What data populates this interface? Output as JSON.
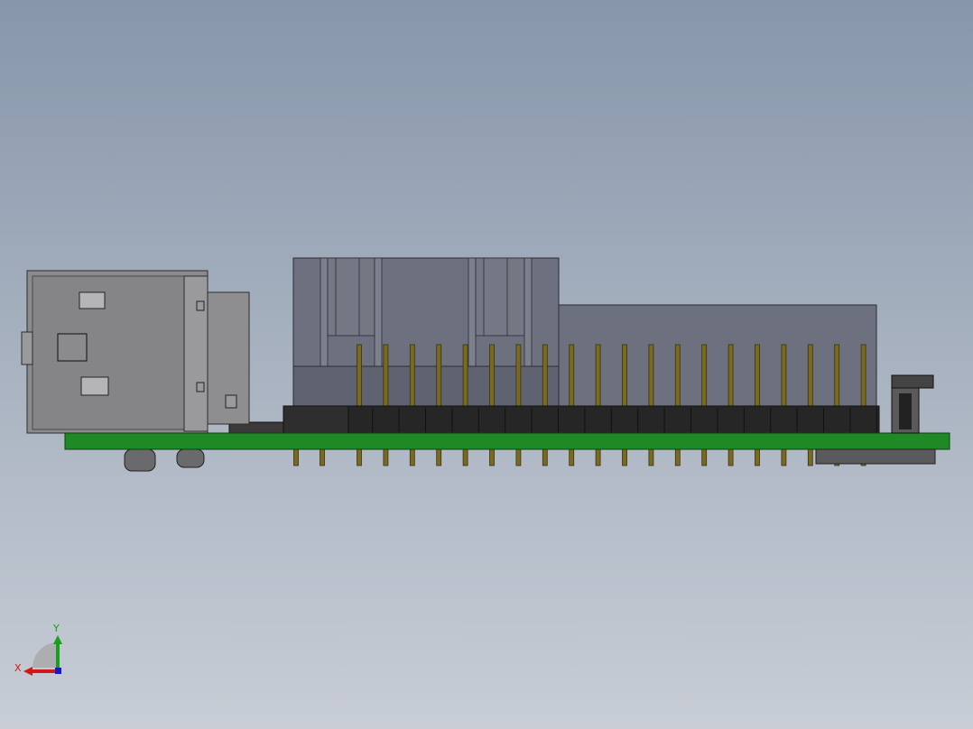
{
  "viewport": {
    "background_top": "#8796ab",
    "background_bottom": "#c8cdd6"
  },
  "model": {
    "pcb_color": "#1f8a25",
    "pin_color": "#7a6a20",
    "header_color": "#2a2a2a",
    "housing_color": "#6f7280",
    "usb_shell_color": "#8a8a8c",
    "header_pin_count": 20
  },
  "triad": {
    "x_label": "X",
    "y_label": "Y",
    "x_color": "#d01818",
    "y_color": "#18a018",
    "z_color": "#1818c8",
    "x_icon": "axis-x-arrow",
    "y_icon": "axis-y-arrow"
  }
}
